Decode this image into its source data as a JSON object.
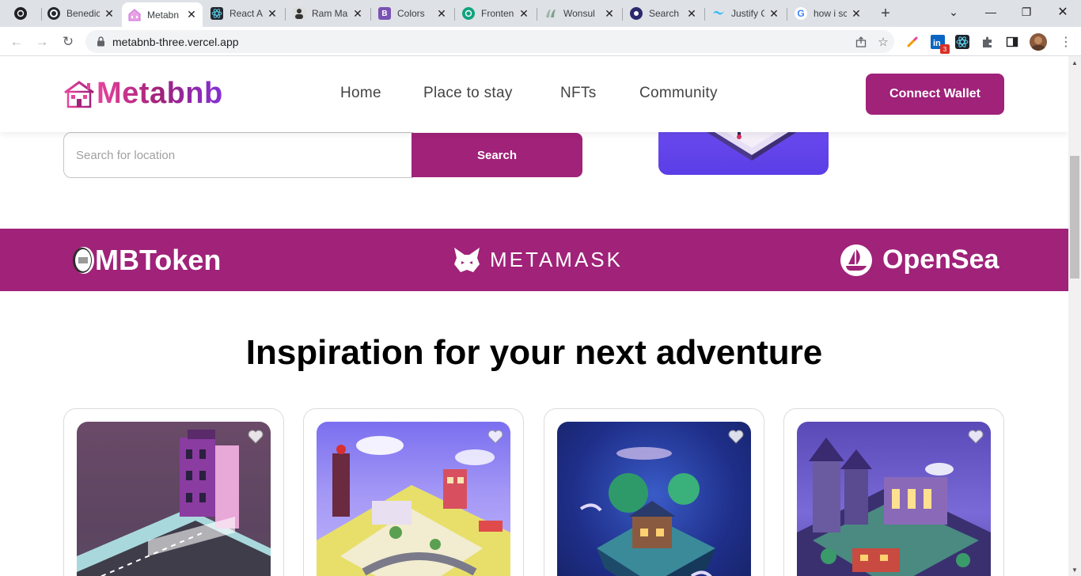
{
  "browser": {
    "tabs": [
      {
        "title": "",
        "favicon": "chatgpt-icon",
        "color": "#202124",
        "active": false
      },
      {
        "title": "Benedic",
        "favicon": "github-icon",
        "color": "#202124",
        "active": false
      },
      {
        "title": "Metabn",
        "favicon": "metabnb-icon",
        "color": "#c86bd6",
        "active": true
      },
      {
        "title": "React A",
        "favicon": "react-icon",
        "color": "#23272f",
        "active": false
      },
      {
        "title": "Ram Ma",
        "favicon": "avatar-icon",
        "color": "#444444",
        "active": false
      },
      {
        "title": "Colors",
        "favicon": "bootstrap-icon",
        "color": "#7952b3",
        "active": false
      },
      {
        "title": "Fronten",
        "favicon": "chatgpt-icon",
        "color": "#10a37f",
        "active": false
      },
      {
        "title": "Wonsul",
        "favicon": "leaf-icon",
        "color": "#9fb8a8",
        "active": false
      },
      {
        "title": "Search",
        "favicon": "search-site-icon",
        "color": "#2b2a6b",
        "active": false
      },
      {
        "title": "Justify C",
        "favicon": "tailwind-icon",
        "color": "#38bdf8",
        "active": false
      },
      {
        "title": "how i sc",
        "favicon": "google-icon",
        "color": "#ffffff",
        "active": false
      }
    ],
    "url": "metabnb-three.vercel.app",
    "extensions": [
      "colorpicker-icon",
      "linkedin-icon",
      "react-devtools-icon",
      "puzzle-icon",
      "sidepanel-icon",
      "profile-avatar"
    ],
    "linkedin_badge": "3"
  },
  "header": {
    "logo": "Metabnb",
    "nav": [
      "Home",
      "Place to stay",
      "NFTs",
      "Community"
    ],
    "cta": "Connect Wallet"
  },
  "search": {
    "placeholder": "Search for location",
    "button": "Search"
  },
  "partners": {
    "mbtoken": "MBToken",
    "metamask": "METAMASK",
    "opensea": "OpenSea"
  },
  "section": {
    "title": "Inspiration for your next adventure"
  },
  "colors": {
    "brand": "#a02279",
    "logo_gradient_start": "#e8439d",
    "logo_gradient_end": "#8231d6"
  }
}
